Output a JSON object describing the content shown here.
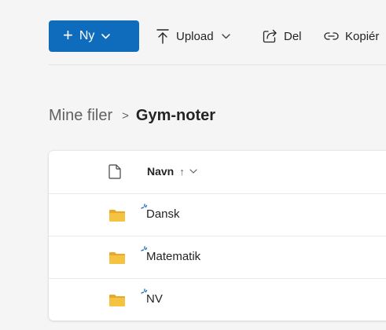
{
  "toolbar": {
    "new_label": "Ny",
    "upload_label": "Upload",
    "share_label": "Del",
    "copy_label": "Kopiér"
  },
  "breadcrumb": {
    "root": "Mine filer",
    "separator": ">",
    "current": "Gym-noter"
  },
  "file_list": {
    "columns": [
      {
        "label": "Navn",
        "sort": "↑",
        "sort_direction": "ascending"
      }
    ],
    "items": [
      {
        "name": "Dansk",
        "type": "folder",
        "new": true
      },
      {
        "name": "Matematik",
        "type": "folder",
        "new": true
      },
      {
        "name": "NV",
        "type": "folder",
        "new": true
      }
    ]
  },
  "colors": {
    "accent": "#0f6cbd",
    "folder": "#f5c342",
    "new_badge": "#0f6cbd",
    "background": "#f5f5f5"
  },
  "icons": {
    "new": "plus-icon",
    "upload": "upload-icon",
    "share": "share-icon",
    "copy": "link-icon",
    "file_type": "document-icon",
    "folder": "folder-icon",
    "new_badge": "sparkle-icon"
  }
}
